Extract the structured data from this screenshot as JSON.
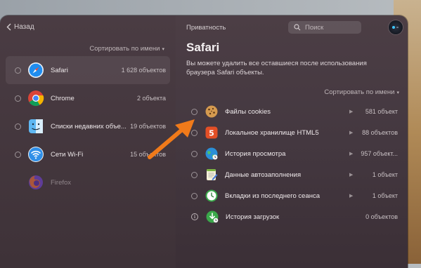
{
  "nav": {
    "back_label": "Назад",
    "page_title": "Приватность"
  },
  "search": {
    "placeholder": "Поиск"
  },
  "left_panel": {
    "sort_label": "Сортировать по имени",
    "apps": [
      {
        "name": "Safari",
        "count": "1 628 объектов",
        "icon": "safari-icon",
        "selected": true
      },
      {
        "name": "Chrome",
        "count": "2 объекта",
        "icon": "chrome-icon"
      },
      {
        "name": "Списки недавних объе...",
        "count": "19 объектов",
        "icon": "finder-icon"
      },
      {
        "name": "Сети Wi-Fi",
        "count": "15 объектов",
        "icon": "wifi-icon"
      },
      {
        "name": "Firefox",
        "count": "",
        "icon": "firefox-icon",
        "dimmed": true
      }
    ]
  },
  "detail": {
    "title": "Safari",
    "description": "Вы можете удалить все оставшиеся после использования браузера Safari объекты.",
    "sort_label": "Сортировать по имени",
    "items": [
      {
        "label": "Файлы cookies",
        "count": "581 объект",
        "icon": "cookie-icon"
      },
      {
        "label": "Локальное хранилище HTML5",
        "count": "88 объектов",
        "icon": "html5-icon"
      },
      {
        "label": "История просмотра",
        "count": "957 объект...",
        "icon": "globe-history-icon"
      },
      {
        "label": "Данные автозаполнения",
        "count": "1 объект",
        "icon": "autofill-notepad-icon"
      },
      {
        "label": "Вкладки из последнего сеанса",
        "count": "1 объект",
        "icon": "clock-tabs-icon"
      },
      {
        "label": "История загрузок",
        "count": "0 объектов",
        "icon": "download-history-icon"
      }
    ]
  },
  "colors": {
    "arrow": "#f07a1a",
    "accent": "#3ec7ff"
  }
}
